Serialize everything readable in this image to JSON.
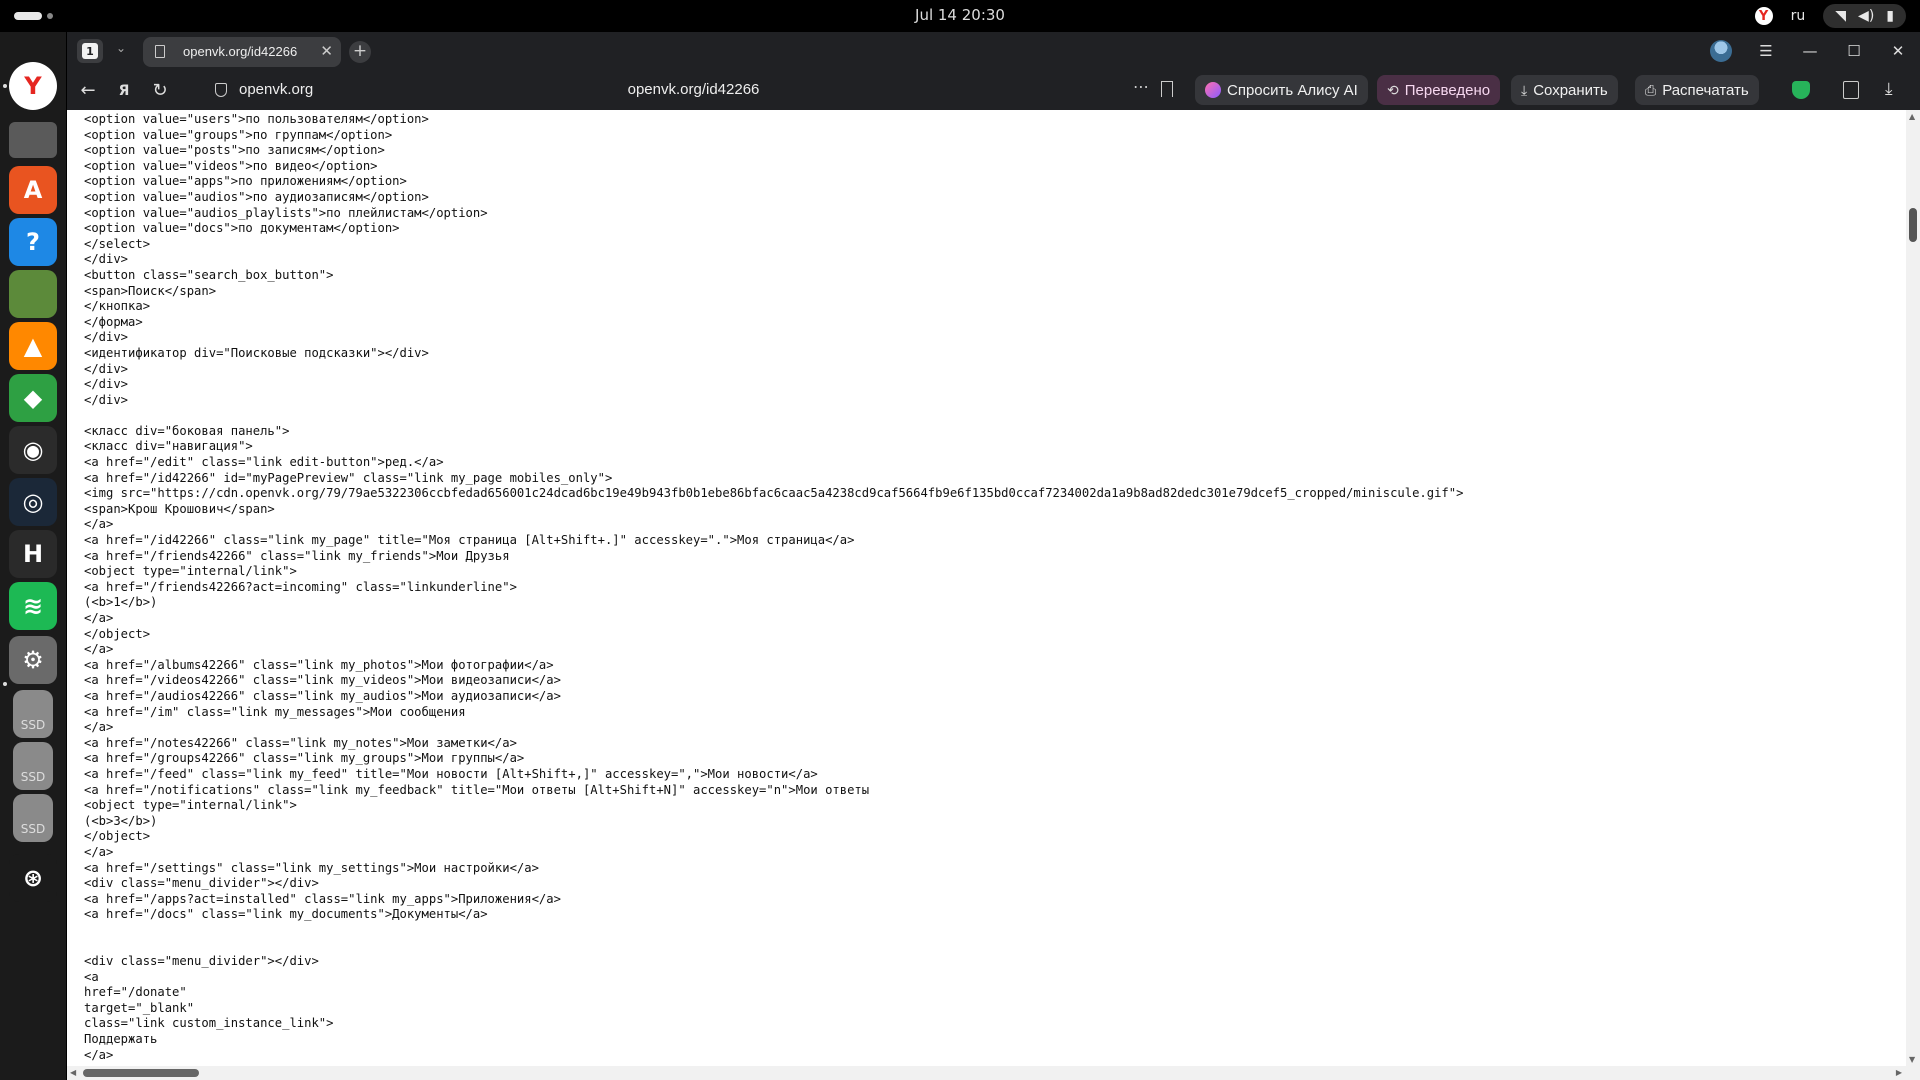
{
  "system_bar": {
    "clock": "Jul 14  20:30",
    "language": "ru"
  },
  "dock": {
    "apps": [
      {
        "name": "yandex-browser-icon",
        "color": "#ffffff",
        "glyph": "Y"
      },
      {
        "name": "files-icon",
        "color": "#5a5a5a",
        "glyph": ""
      },
      {
        "name": "app-center-icon",
        "color": "#e95420",
        "glyph": "A"
      },
      {
        "name": "help-icon",
        "color": "#1e88e5",
        "glyph": "?"
      },
      {
        "name": "minecraft-icon",
        "color": "#5c8a3a",
        "glyph": ""
      },
      {
        "name": "vlc-icon",
        "color": "#ff8800",
        "glyph": "▲"
      },
      {
        "name": "roblox-icon",
        "color": "#2ea043",
        "glyph": "◆"
      },
      {
        "name": "obs-icon",
        "color": "#2b2b2b",
        "glyph": "◉"
      },
      {
        "name": "steam-icon",
        "color": "#1b2838",
        "glyph": "◎"
      },
      {
        "name": "hytale-icon",
        "color": "#2a2a2a",
        "glyph": "H"
      },
      {
        "name": "spotify-icon",
        "color": "#1db954",
        "glyph": "≋"
      },
      {
        "name": "settings-icon",
        "color": "#6a6a6a",
        "glyph": "⚙"
      },
      {
        "name": "ssd-drive-icon",
        "color": "#8a8a8a",
        "glyph": "SSD"
      },
      {
        "name": "ssd-drive-icon",
        "color": "#8a8a8a",
        "glyph": "SSD"
      },
      {
        "name": "ssd-drive-icon",
        "color": "#8a8a8a",
        "glyph": "SSD"
      },
      {
        "name": "show-apps-icon",
        "color": "#1b1b1b",
        "glyph": "⊛"
      }
    ]
  },
  "browser": {
    "tab_count": "1",
    "tab_title": "openvk.org/id42266",
    "domain": "openvk.org",
    "url": "openvk.org/id42266",
    "ask_alice_label": "Спросить Алису AI",
    "translated_label": "Переведено",
    "save_label": "Сохранить",
    "print_label": "Распечатать"
  },
  "source_lines": [
    "<option value=\"users\">по пользователям</option>",
    "<option value=\"groups\">по группам</option>",
    "<option value=\"posts\">по записям</option>",
    "<option value=\"videos\">по видео</option>",
    "<option value=\"apps\">по приложениям</option>",
    "<option value=\"audios\">по аудиозаписям</option>",
    "<option value=\"audios_playlists\">по плейлистам</option>",
    "<option value=\"docs\">по документам</option>",
    "</select>",
    "</div>",
    "<button class=\"search_box_button\">",
    "<span>Поиск</span>",
    "</кнопка>",
    "</форма>",
    "</div>",
    "<идентификатор div=\"Поисковые подсказки\"></div>",
    "</div>",
    "</div>",
    "</div>",
    "",
    "<класс div=\"боковая панель\">",
    "<класс div=\"навигация\">",
    "<a href=\"/edit\" class=\"link edit-button\">ред.</a>",
    "<a href=\"/id42266\" id=\"myPagePreview\" class=\"link my_page mobiles_only\">",
    "<img src=\"https://cdn.openvk.org/79/79ae5322306ccbfedad656001c24dcad6bc19e49b943fb0b1ebe86bfac6caac5a4238cd9caf5664fb9e6f135bd0ccaf7234002da1a9b8ad82dedc301e79dcef5_cropped/miniscule.gif\">",
    "<span>Крош Крошович</span>",
    "</a>",
    "<a href=\"/id42266\" class=\"link my_page\" title=\"Моя страница [Alt+Shift+.]\" accesskey=\".\">Моя страница</a>",
    "<a href=\"/friends42266\" class=\"link my_friends\">Мои Друзья",
    "<object type=\"internal/link\">",
    "<a href=\"/friends42266?act=incoming\" class=\"linkunderline\">",
    "(<b>1</b>)",
    "</a>",
    "</object>",
    "</a>",
    "<a href=\"/albums42266\" class=\"link my_photos\">Мои фотографии</a>",
    "<a href=\"/videos42266\" class=\"link my_videos\">Мои видеозаписи</a>",
    "<a href=\"/audios42266\" class=\"link my_audios\">Мои аудиозаписи</a>",
    "<a href=\"/im\" class=\"link my_messages\">Мои сообщения",
    "</a>",
    "<a href=\"/notes42266\" class=\"link my_notes\">Мои заметки</a>",
    "<a href=\"/groups42266\" class=\"link my_groups\">Мои группы</a>",
    "<a href=\"/feed\" class=\"link my_feed\" title=\"Мои новости [Alt+Shift+,]\" accesskey=\",\">Мои новости</a>",
    "<a href=\"/notifications\" class=\"link my_feedback\" title=\"Мои ответы [Alt+Shift+N]\" accesskey=\"n\">Мои ответы",
    "<object type=\"internal/link\">",
    "(<b>3</b>)",
    "</object>",
    "</a>",
    "<a href=\"/settings\" class=\"link my_settings\">Мои настройки</a>",
    "<div class=\"menu_divider\"></div>",
    "<a href=\"/apps?act=installed\" class=\"link my_apps\">Приложения</a>",
    "<a href=\"/docs\" class=\"link my_documents\">Документы</a>",
    "",
    "",
    "<div class=\"menu_divider\"></div>",
    "<a",
    "href=\"/donate\"",
    "target=\"_blank\"",
    "class=\"link custom_instance_link\">",
    "Поддержать",
    "</a>"
  ]
}
